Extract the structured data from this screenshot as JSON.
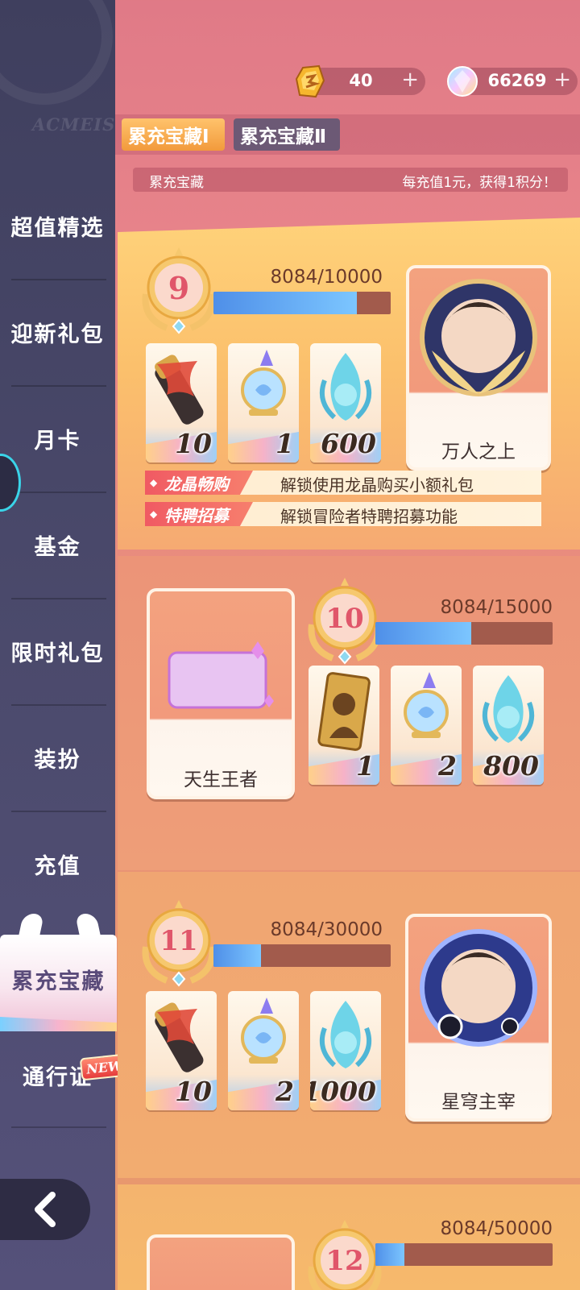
{
  "sidebar": {
    "logo_text": "ACMEIS",
    "items": [
      {
        "label": "超值精选"
      },
      {
        "label": "迎新礼包"
      },
      {
        "label": "月卡"
      },
      {
        "label": "基金"
      },
      {
        "label": "限时礼包"
      },
      {
        "label": "装扮"
      },
      {
        "label": "充值"
      },
      {
        "label": "累充宝藏",
        "active": true
      },
      {
        "label": "通行证",
        "badge": "NEW!"
      }
    ],
    "back_icon": "chevron-left-icon"
  },
  "currencies": [
    {
      "icon": "dragon-crystal-icon",
      "value": "40"
    },
    {
      "icon": "rainbow-gem-icon",
      "value": "66269"
    }
  ],
  "tabs": [
    {
      "label": "累充宝藏Ⅰ",
      "active": true
    },
    {
      "label": "累充宝藏Ⅱ",
      "active": false
    }
  ],
  "info": {
    "title": "累充宝藏",
    "rule": "每充值1元，获得1积分！"
  },
  "tiers": [
    {
      "level": "9",
      "progress_text": "8084/10000",
      "progress": 0.8084,
      "items": [
        {
          "icon": "scroll-icon",
          "qty": "10"
        },
        {
          "icon": "crystal-orb-icon",
          "qty": "1"
        },
        {
          "icon": "soul-flame-icon",
          "qty": "600"
        }
      ],
      "reward": {
        "label": "万人之上",
        "icon": "avatar-frame-icon"
      },
      "perks": [
        {
          "tag": "龙晶畅购",
          "text": "解锁使用龙晶购买小额礼包"
        },
        {
          "tag": "特聘招募",
          "text": "解锁冒险者特聘招募功能"
        }
      ]
    },
    {
      "level": "10",
      "progress_text": "8084/15000",
      "progress": 0.539,
      "items": [
        {
          "icon": "hero-card-icon",
          "qty": "1"
        },
        {
          "icon": "crystal-orb-icon",
          "qty": "2"
        },
        {
          "icon": "soul-flame-icon",
          "qty": "800"
        }
      ],
      "reward": {
        "label": "天生王者",
        "icon": "chat-bubble-frame-icon"
      }
    },
    {
      "level": "11",
      "progress_text": "8084/30000",
      "progress": 0.269,
      "items": [
        {
          "icon": "scroll-icon",
          "qty": "10"
        },
        {
          "icon": "crystal-orb-icon",
          "qty": "2"
        },
        {
          "icon": "soul-flame-icon",
          "qty": "1000"
        }
      ],
      "reward": {
        "label": "星穹主宰",
        "icon": "avatar-frame-icon"
      }
    },
    {
      "level": "12",
      "progress_text": "8084/50000",
      "progress": 0.162
    }
  ]
}
